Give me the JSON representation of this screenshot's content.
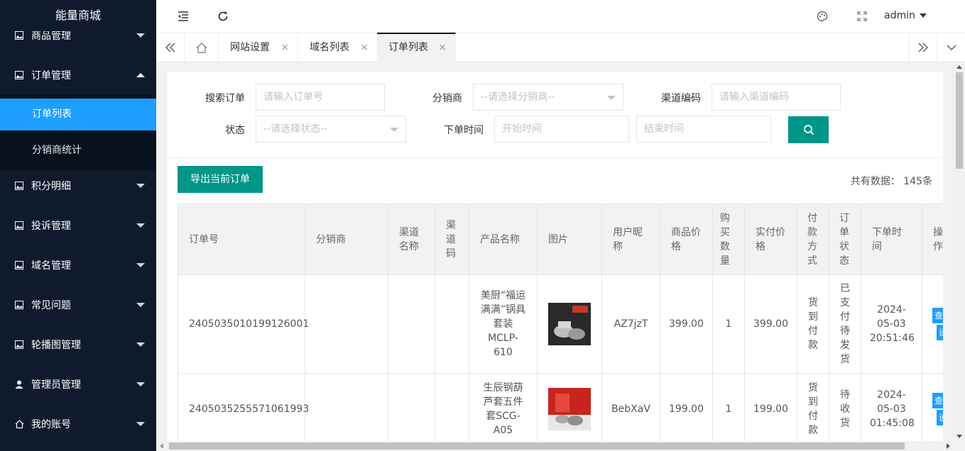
{
  "app": {
    "title": "能量商城",
    "user": "admin"
  },
  "sidebar": {
    "items": [
      {
        "label": "商品管理",
        "icon": "image-icon"
      },
      {
        "label": "订单管理",
        "icon": "image-icon",
        "expanded": true
      },
      {
        "label": "积分明细",
        "icon": "image-icon"
      },
      {
        "label": "投诉管理",
        "icon": "image-icon"
      },
      {
        "label": "域名管理",
        "icon": "image-icon"
      },
      {
        "label": "常见问题",
        "icon": "image-icon"
      },
      {
        "label": "轮播图管理",
        "icon": "image-icon"
      },
      {
        "label": "管理员管理",
        "icon": "user-icon"
      },
      {
        "label": "我的账号",
        "icon": "home-icon"
      }
    ],
    "submenu": [
      {
        "label": "订单列表",
        "active": true
      },
      {
        "label": "分销商统计",
        "active": false
      }
    ]
  },
  "tabs": [
    {
      "label": "网站设置"
    },
    {
      "label": "域名列表"
    },
    {
      "label": "订单列表",
      "active": true
    }
  ],
  "tab_close": "×",
  "filters": {
    "search_order": {
      "label": "搜索订单",
      "placeholder": "请输入订单号"
    },
    "distributor": {
      "label": "分销商",
      "placeholder": "--请选择分销商--"
    },
    "channel_code": {
      "label": "渠道编码",
      "placeholder": "请输入渠道编码"
    },
    "status": {
      "label": "状态",
      "placeholder": "--请选择状态--"
    },
    "order_time": {
      "label": "下单时间",
      "start_placeholder": "开始时间",
      "end_placeholder": "结束时间"
    }
  },
  "toolbar": {
    "export_label": "导出当前订单",
    "total_label": "共有数据： 145条"
  },
  "table": {
    "headers": [
      "订单号",
      "分销商",
      "渠道名称",
      "渠道码",
      "产品名称",
      "图片",
      "用户昵称",
      "商品价格",
      "购买数量",
      "实付价格",
      "付款方式",
      "订单状态",
      "下单时间",
      "操作"
    ],
    "rows": [
      {
        "order_no": "2405035010199126001",
        "distributor": "",
        "channel_name": "",
        "channel_code": "",
        "product": "美厨“福运满满”锅具套装MCLP-610",
        "nickname": "AZ7jzT",
        "price": "399.00",
        "qty": "1",
        "paid": "399.00",
        "pay_method": "货到付款",
        "status": "已支付待发货",
        "time": "2024-05-03 20:51:46",
        "actions": [
          "查看",
          "设置"
        ]
      },
      {
        "order_no": "2405035255571061993",
        "distributor": "",
        "channel_name": "",
        "channel_code": "",
        "product": "生辰钢葫芦套五件套SCG-A05",
        "nickname": "BebXaV",
        "price": "199.00",
        "qty": "1",
        "paid": "199.00",
        "pay_method": "货到付款",
        "status": "待收货",
        "time": "2024-05-03 01:45:08",
        "actions": [
          "查看",
          "设置"
        ]
      }
    ]
  },
  "colors": {
    "sidebar_bg": "#0f1b2d",
    "accent_blue": "#1e9fff",
    "primary_green": "#009688"
  }
}
